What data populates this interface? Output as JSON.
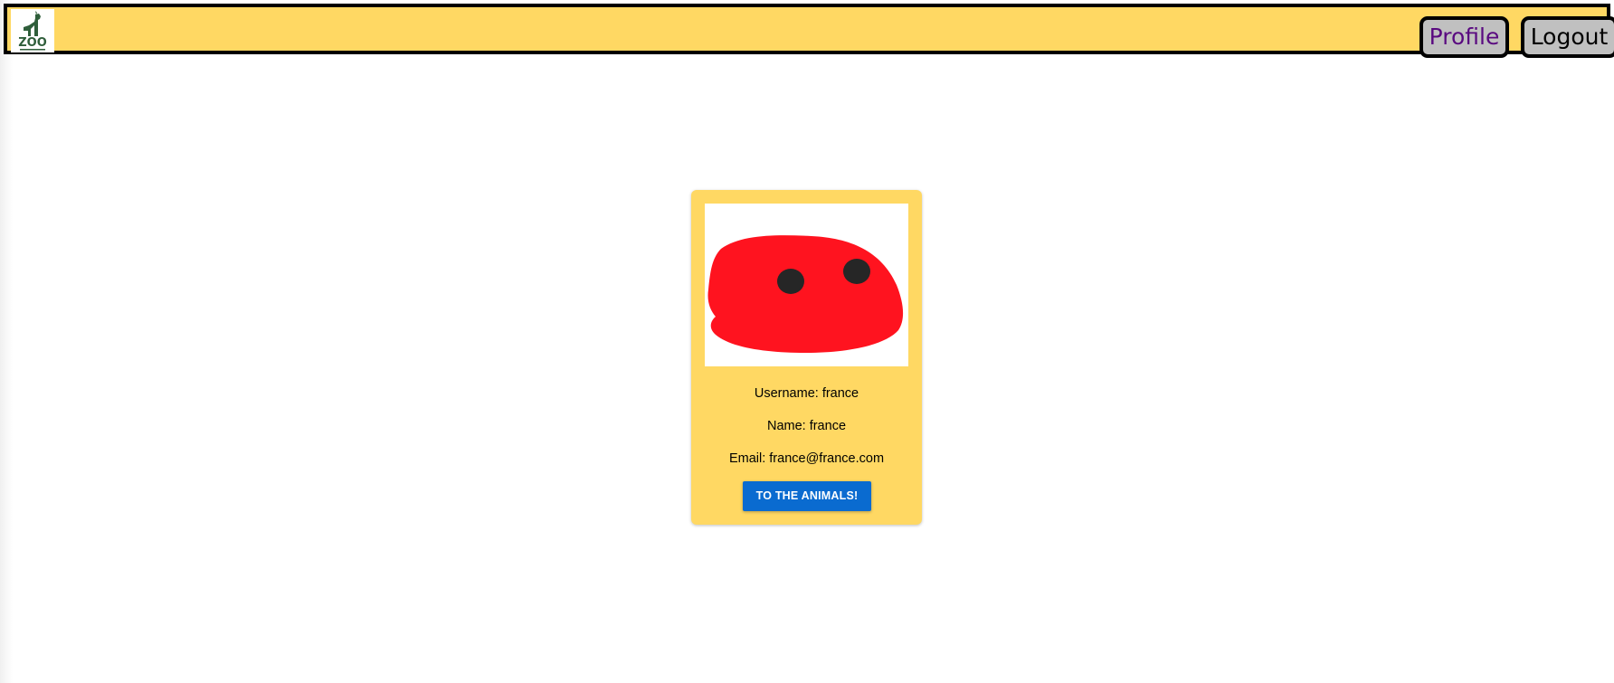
{
  "navbar": {
    "logo_icon": "zoo-logo-icon",
    "logo_text": "ZOO",
    "profile_label": "Profile",
    "logout_label": "Logout",
    "background_color": "#ffd863"
  },
  "profile_card": {
    "avatar_icon": "red-blob-avatar-icon",
    "username_label": "Username: france",
    "name_label": "Name: france",
    "email_label": "Email: france@france.com",
    "action_label": "TO THE ANIMALS!",
    "card_color": "#ffd863",
    "button_color": "#0a6bd0",
    "avatar_color": "#ff131f"
  }
}
